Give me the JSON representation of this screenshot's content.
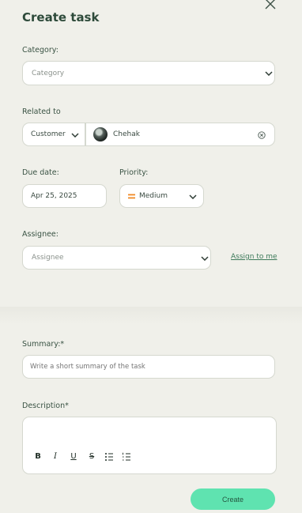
{
  "dialog": {
    "title": "Create task"
  },
  "category": {
    "label": "Category:",
    "value": "Category"
  },
  "related": {
    "label": "Related to",
    "type": "Customer",
    "name": "Chehak"
  },
  "due_date": {
    "label": "Due date:",
    "value": "Apr 25, 2025"
  },
  "priority": {
    "label": "Priority:",
    "value": "Medium",
    "color": "#f08a24"
  },
  "assignee": {
    "label": "Assignee:",
    "value": "Assignee",
    "assign_to_me": "Assign to me"
  },
  "summary": {
    "label": "Summary:*",
    "placeholder": "Write a short summary of the task"
  },
  "description": {
    "label": "Description*",
    "toolbar": [
      {
        "icon": "bold-icon",
        "glyph": "B"
      },
      {
        "icon": "italic-icon",
        "glyph": "I"
      },
      {
        "icon": "underline-icon",
        "glyph": "U"
      },
      {
        "icon": "strikethrough-icon",
        "glyph": "S"
      },
      {
        "icon": "bulleted-list-icon",
        "glyph": ""
      },
      {
        "icon": "numbered-list-icon",
        "glyph": ""
      }
    ]
  },
  "actions": {
    "create": "Create"
  }
}
